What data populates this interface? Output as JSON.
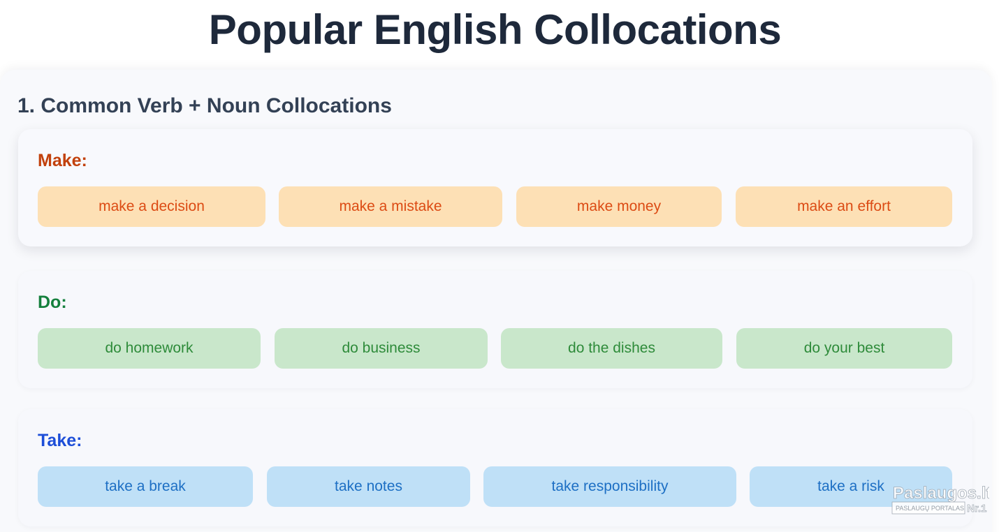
{
  "page": {
    "title": "Popular English Collocations"
  },
  "section": {
    "heading": "1. Common Verb + Noun Collocations"
  },
  "colors": {
    "make_text": "#c2410c",
    "make_chip_bg": "#fde0b5",
    "make_chip_text": "#dc4b14",
    "do_text": "#15803d",
    "do_chip_bg": "#c9e7cb",
    "do_chip_text": "#2e8b3a",
    "take_text": "#1d4ed8",
    "take_chip_bg": "#bfe0f7",
    "take_chip_text": "#1d6fc4"
  },
  "groups": [
    {
      "label": "Make:",
      "items": [
        "make a decision",
        "make a mistake",
        "make money",
        "make an effort"
      ]
    },
    {
      "label": "Do:",
      "items": [
        "do homework",
        "do business",
        "do the dishes",
        "do your best"
      ]
    },
    {
      "label": "Take:",
      "items": [
        "take a break",
        "take notes",
        "take responsibility",
        "take a risk"
      ]
    }
  ],
  "watermark": {
    "brand": "Paslaugos.lt",
    "tagline": "PASLAUGŲ PORTALAS",
    "badge": "Nr.1"
  }
}
